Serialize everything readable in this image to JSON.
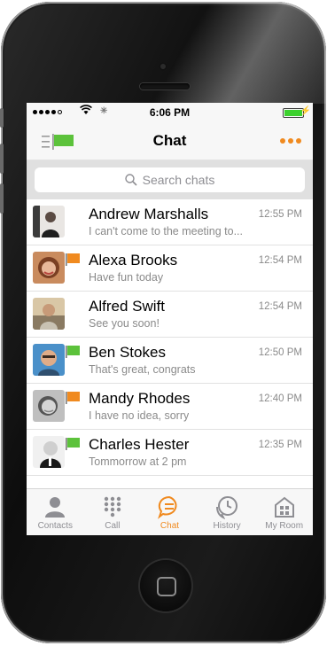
{
  "status": {
    "time": "6:06 PM"
  },
  "nav": {
    "title": "Chat"
  },
  "search": {
    "placeholder": "Search chats"
  },
  "chats": [
    {
      "name": "Andrew Marshalls",
      "preview": "I can't come to the meeting to...",
      "time": "12:55 PM",
      "flag": ""
    },
    {
      "name": "Alexa Brooks",
      "preview": "Have fun today",
      "time": "12:54 PM",
      "flag": "orange"
    },
    {
      "name": "Alfred Swift",
      "preview": "See you soon!",
      "time": "12:54 PM",
      "flag": ""
    },
    {
      "name": "Ben Stokes",
      "preview": "That's great, congrats",
      "time": "12:50 PM",
      "flag": "green"
    },
    {
      "name": "Mandy Rhodes",
      "preview": "I have no idea, sorry",
      "time": "12:40 PM",
      "flag": "orange"
    },
    {
      "name": "Charles Hester",
      "preview": "Tommorrow at 2 pm",
      "time": "12:35 PM",
      "flag": "green"
    }
  ],
  "tabs": [
    {
      "label": "Contacts",
      "icon": "person-icon"
    },
    {
      "label": "Call",
      "icon": "keypad-icon"
    },
    {
      "label": "Chat",
      "icon": "chat-bubble-icon",
      "active": true
    },
    {
      "label": "History",
      "icon": "clock-phone-icon"
    },
    {
      "label": "My Room",
      "icon": "house-icon"
    }
  ],
  "colors": {
    "accent": "#f08a1f",
    "flag_green": "#5cc23b",
    "flag_orange": "#f08a1f"
  }
}
